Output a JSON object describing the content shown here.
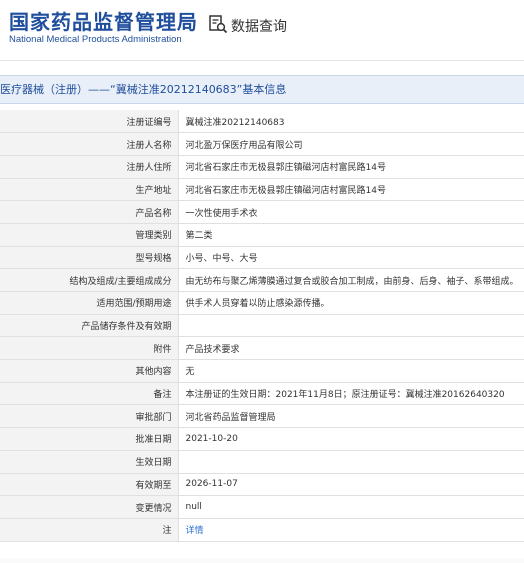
{
  "header": {
    "logo_cn": "国家药品监督管理局",
    "logo_en": "National Medical Products Administration",
    "search_label": "数据查询"
  },
  "title": "医疗器械（注册）——“冀械注准20212140683”基本信息",
  "rows": [
    {
      "label": "注册证编号",
      "value": "冀械注准20212140683"
    },
    {
      "label": "注册人名称",
      "value": "河北盈万保医疗用品有限公司"
    },
    {
      "label": "注册人住所",
      "value": "河北省石家庄市无极县郭庄镇磁河店村富民路14号"
    },
    {
      "label": "生产地址",
      "value": "河北省石家庄市无极县郭庄镇磁河店村富民路14号"
    },
    {
      "label": "产品名称",
      "value": "一次性使用手术衣"
    },
    {
      "label": "管理类别",
      "value": "第二类"
    },
    {
      "label": "型号规格",
      "value": "小号、中号、大号"
    },
    {
      "label": "结构及组成/主要组成成分",
      "value": "由无纺布与聚乙烯薄膜通过复合或胶合加工制成，由前身、后身、袖子、系带组成。"
    },
    {
      "label": "适用范围/预期用途",
      "value": "供手术人员穿着以防止感染源传播。"
    },
    {
      "label": "产品储存条件及有效期",
      "value": ""
    },
    {
      "label": "附件",
      "value": "产品技术要求"
    },
    {
      "label": "其他内容",
      "value": "无"
    },
    {
      "label": "备注",
      "value": "本注册证的生效日期：2021年11月8日；原注册证号：冀械注准20162640320"
    },
    {
      "label": "审批部门",
      "value": "河北省药品监督管理局"
    },
    {
      "label": "批准日期",
      "value": "2021-10-20"
    },
    {
      "label": "生效日期",
      "value": ""
    },
    {
      "label": "有效期至",
      "value": "2026-11-07"
    },
    {
      "label": "变更情况",
      "value": "null"
    },
    {
      "label": "注",
      "value": "详情",
      "link": true
    }
  ],
  "colors": {
    "brand": "#1f4e9c",
    "title_bg": "#e9eff8",
    "link": "#2f6fd0"
  }
}
